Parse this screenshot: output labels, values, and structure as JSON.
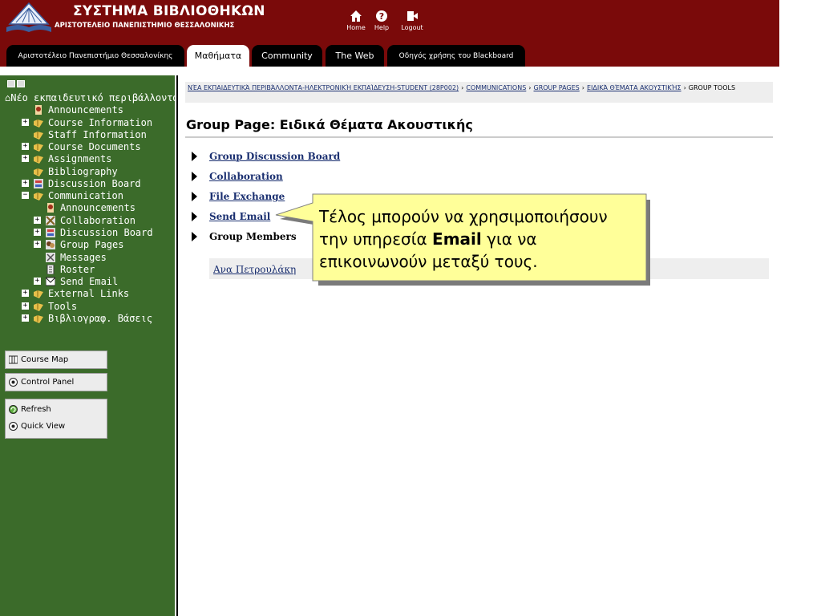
{
  "header": {
    "system_title": "ΣΥΣΤΗΜΑ ΒΙΒΛΙΟΘΗΚΩΝ",
    "university_title": "ΑΡΙΣΤΟΤΕΛΕΙΟ ΠΑΝΕΠΙΣΤΗΜΙΟ ΘΕΣΣΑΛΟΝΙΚΗΣ",
    "nav": [
      {
        "label": "Home",
        "icon": "home-icon"
      },
      {
        "label": "Help",
        "icon": "help-icon"
      },
      {
        "label": "Logout",
        "icon": "logout-icon"
      }
    ],
    "brand_color": "#7a0a0a"
  },
  "tabs": [
    {
      "label": "Αριστοτέλειο Πανεπιστήμιο Θεσσαλονίκης",
      "active": false
    },
    {
      "label": "Μαθήματα",
      "active": true
    },
    {
      "label": "Community",
      "active": false
    },
    {
      "label": "The Web",
      "active": false
    },
    {
      "label": "Οδηγός χρήσης του Blackboard",
      "active": false
    }
  ],
  "sidebar": {
    "root_label": "Νέο εκπαιδευτικό περιβάλλοντα",
    "items": [
      {
        "label": "Announcements",
        "icon": "announcement-icon",
        "expandable": false,
        "level": 1
      },
      {
        "label": "Course Information",
        "icon": "folder-icon",
        "expandable": true,
        "level": 1
      },
      {
        "label": "Staff Information",
        "icon": "folder-icon",
        "expandable": false,
        "level": 1
      },
      {
        "label": "Course Documents",
        "icon": "folder-icon",
        "expandable": true,
        "level": 1
      },
      {
        "label": "Assignments",
        "icon": "folder-icon",
        "expandable": true,
        "level": 1
      },
      {
        "label": "Bibliography",
        "icon": "folder-icon",
        "expandable": false,
        "level": 1
      },
      {
        "label": "Discussion Board",
        "icon": "discussion-icon",
        "expandable": true,
        "level": 1
      },
      {
        "label": "Communication",
        "icon": "folder-icon",
        "expandable": true,
        "expanded": true,
        "level": 1
      },
      {
        "label": "Announcements",
        "icon": "announcement-icon",
        "expandable": false,
        "level": 2
      },
      {
        "label": "Collaboration",
        "icon": "collaboration-icon",
        "expandable": true,
        "level": 2
      },
      {
        "label": "Discussion Board",
        "icon": "discussion-icon",
        "expandable": true,
        "level": 2
      },
      {
        "label": "Group Pages",
        "icon": "group-icon",
        "expandable": true,
        "level": 2
      },
      {
        "label": "Messages",
        "icon": "messages-icon",
        "expandable": false,
        "level": 2
      },
      {
        "label": "Roster",
        "icon": "roster-icon",
        "expandable": false,
        "level": 2
      },
      {
        "label": "Send Email",
        "icon": "email-icon",
        "expandable": true,
        "level": 2
      },
      {
        "label": "External Links",
        "icon": "folder-icon",
        "expandable": true,
        "level": 1
      },
      {
        "label": "Tools",
        "icon": "folder-icon",
        "expandable": true,
        "level": 1
      },
      {
        "label": "Βιβλιογραφ. Βάσεις",
        "icon": "folder-icon",
        "expandable": true,
        "level": 1
      }
    ],
    "buttons": {
      "course_map": "Course Map",
      "control_panel": "Control Panel",
      "refresh": "Refresh",
      "quick_view": "Quick View"
    },
    "bg_color": "#3b6b2a"
  },
  "breadcrumb": {
    "items": [
      "ΝΈΑ ΕΚΠΑΙΔΕΥΤΙΚΆ ΠΕΡΙΒΆΛΛΟΝΤΑ-ΗΛΕΚΤΡΟΝΙΚΉ ΕΚΠΑΊΔΕΥΣΗ-STUDENT (28P002)",
      "COMMUNICATIONS",
      "GROUP PAGES",
      "ΕΙΔΙΚΆ ΘΈΜΑΤΑ ΑΚΟΥΣΤΙΚΉΣ"
    ],
    "current": "GROUP TOOLS"
  },
  "main": {
    "title": "Group Page: Ειδικά Θέματα Ακουστικής",
    "links": [
      {
        "label": "Group Discussion Board",
        "link": true
      },
      {
        "label": "Collaboration",
        "link": true
      },
      {
        "label": "File Exchange",
        "link": true
      },
      {
        "label": "Send Email",
        "link": true
      },
      {
        "label": "Group Members",
        "link": false
      }
    ],
    "member": "Ανα Πετρουλάκη"
  },
  "callout": {
    "text_before": "Τέλος μπορούν να χρησιμοποιήσουν την υπηρεσία ",
    "text_bold": "Email",
    "text_after": " για να επικοινωνούν μεταξύ τους."
  }
}
